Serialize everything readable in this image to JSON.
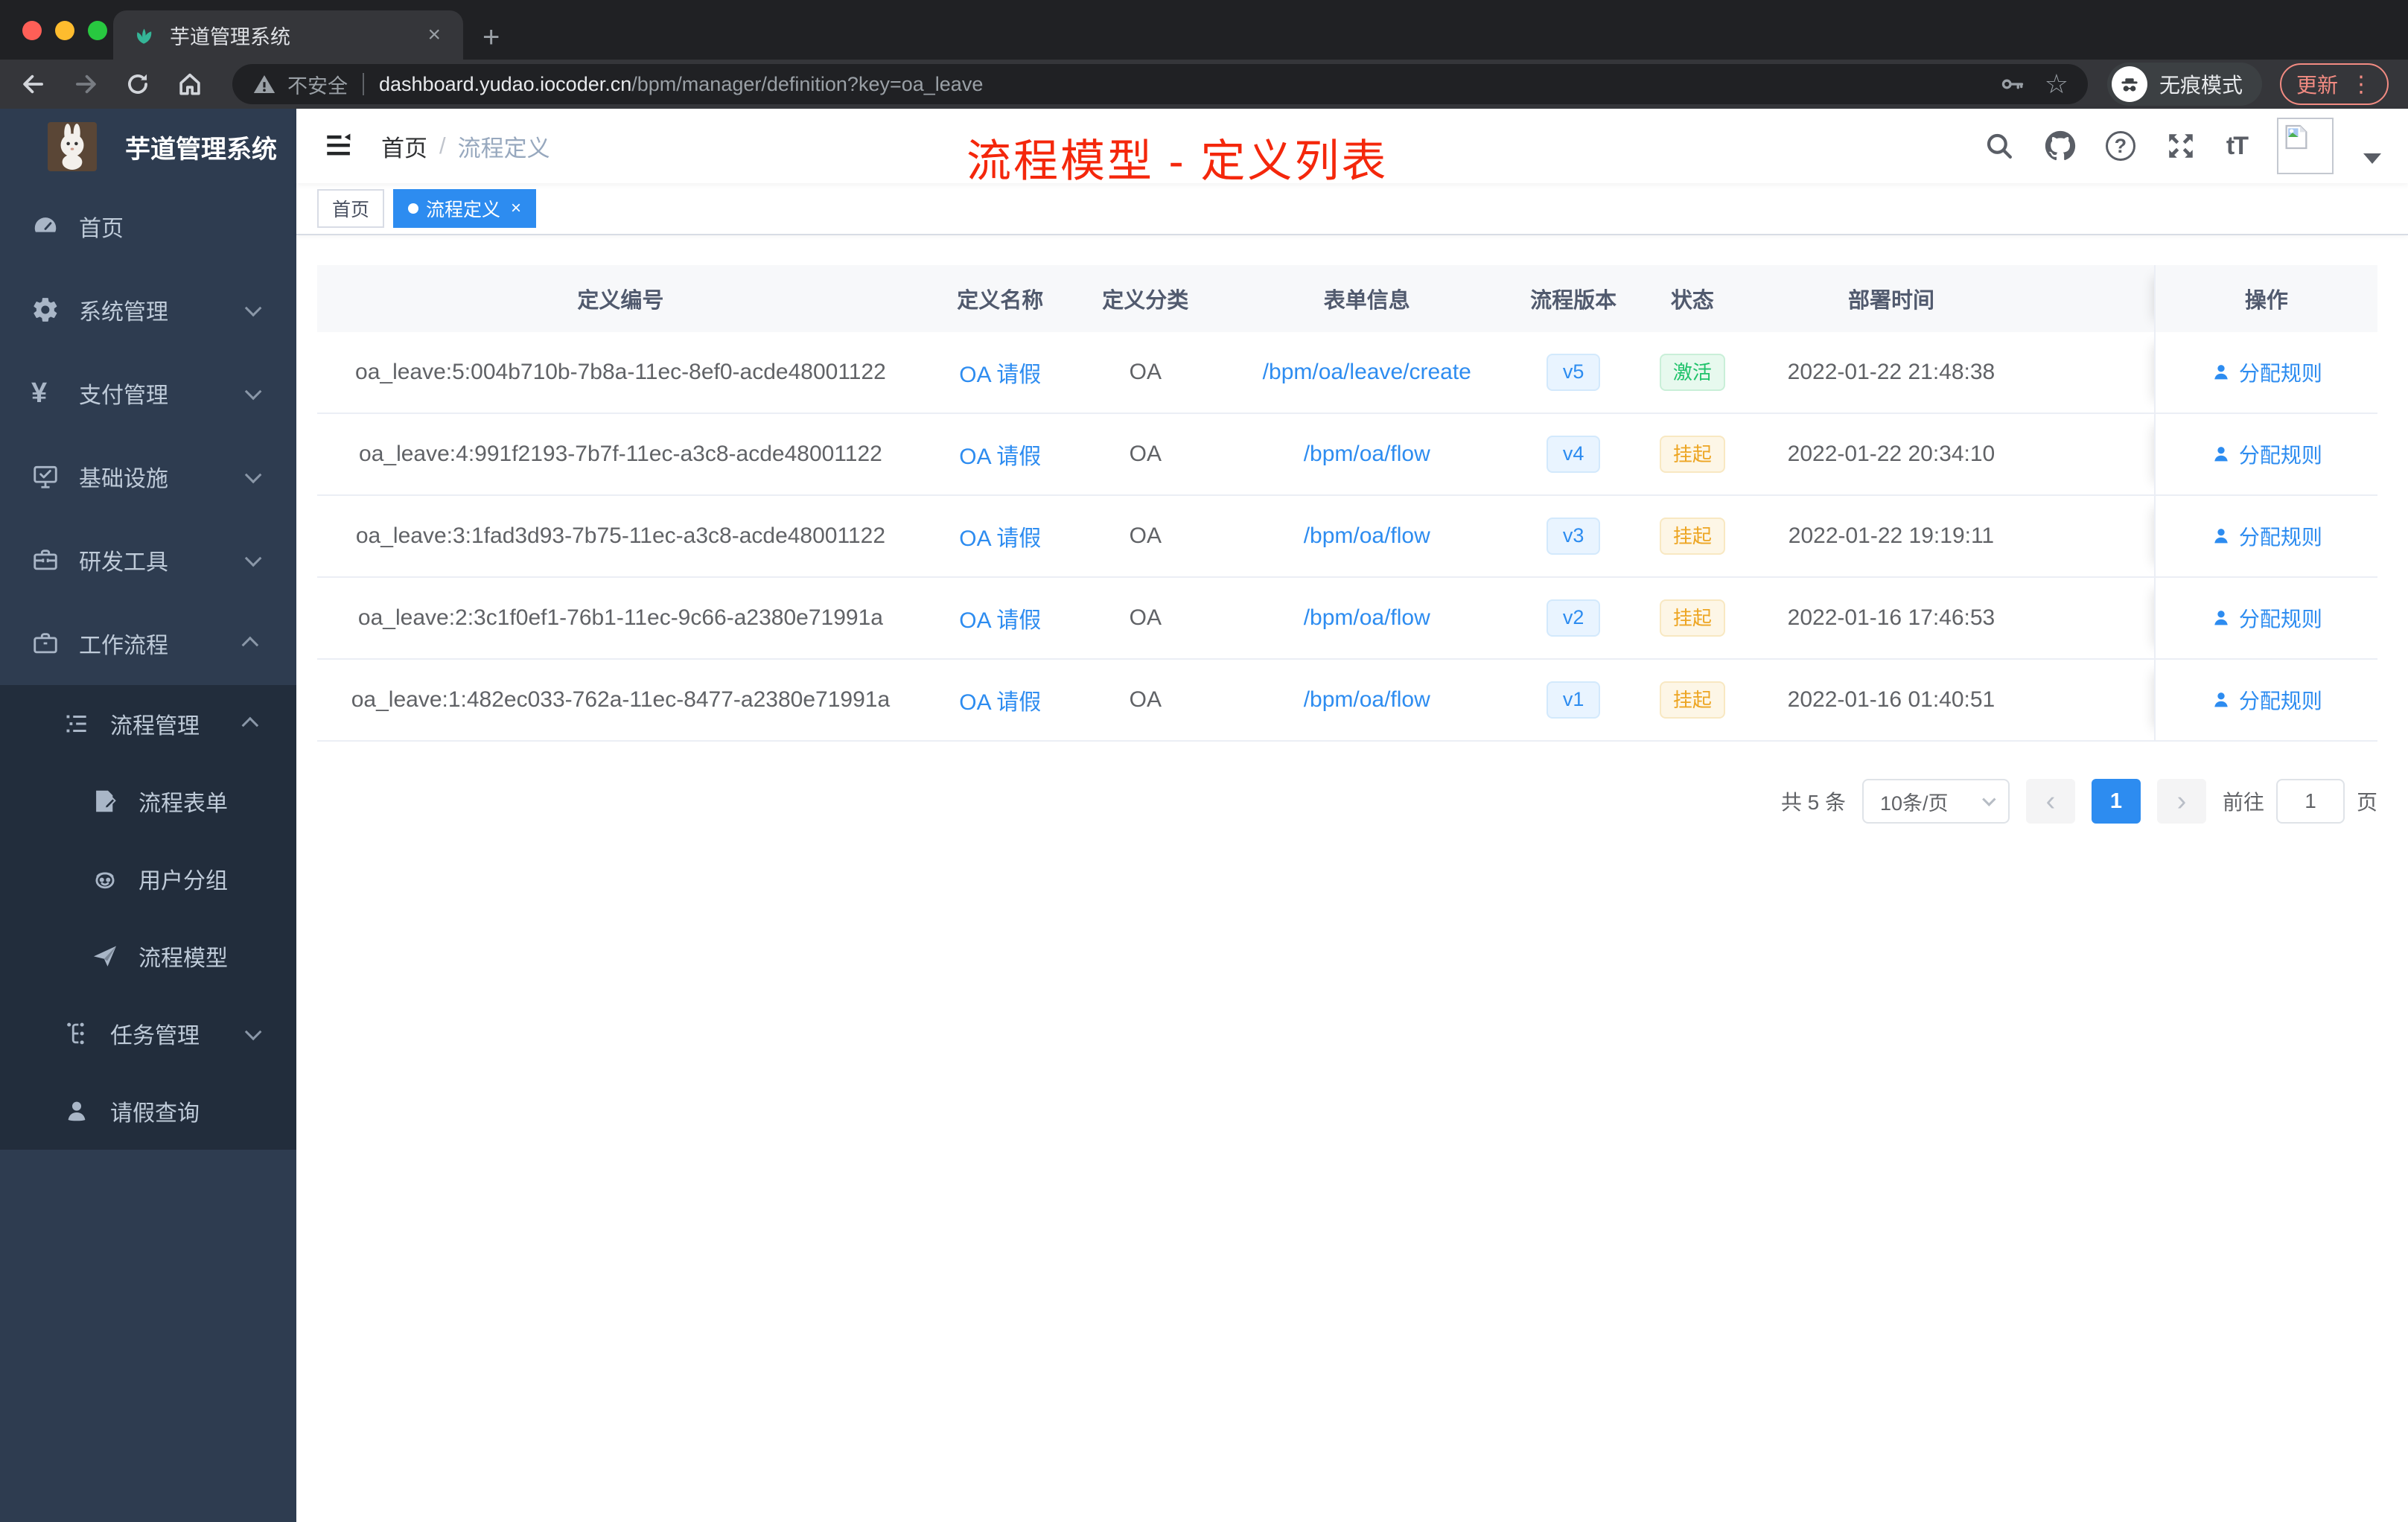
{
  "browser": {
    "tab_title": "芋道管理系统",
    "security_label": "不安全",
    "url_domain": "dashboard.yudao.iocoder.cn",
    "url_path": "/bpm/manager/definition?key=oa_leave",
    "incognito_label": "无痕模式",
    "update_label": "更新"
  },
  "icons": {
    "close": "×",
    "plus": "+",
    "star": "☆",
    "kebab": "⋮",
    "question": "?",
    "fontsize": "tT",
    "yen": "¥",
    "prev": "‹",
    "next": "›"
  },
  "sidebar": {
    "title": "芋道管理系统",
    "items": [
      {
        "key": "home",
        "label": "首页",
        "icon": "dashboard-icon",
        "chevron": ""
      },
      {
        "key": "system",
        "label": "系统管理",
        "icon": "gear-icon",
        "chevron": "down"
      },
      {
        "key": "payment",
        "label": "支付管理",
        "icon": "yen-icon",
        "chevron": "down"
      },
      {
        "key": "infra",
        "label": "基础设施",
        "icon": "monitor-icon",
        "chevron": "down"
      },
      {
        "key": "devtools",
        "label": "研发工具",
        "icon": "toolbox-icon",
        "chevron": "down"
      },
      {
        "key": "workflow",
        "label": "工作流程",
        "icon": "briefcase-icon",
        "chevron": "up"
      }
    ],
    "nested_items": [
      {
        "key": "process-mgmt",
        "label": "流程管理",
        "icon": "list-tree-icon",
        "chevron": "up",
        "level": 1
      },
      {
        "key": "process-form",
        "label": "流程表单",
        "icon": "form-edit-icon",
        "chevron": "",
        "level": 2
      },
      {
        "key": "user-group",
        "label": "用户分组",
        "icon": "robot-icon",
        "chevron": "",
        "level": 2
      },
      {
        "key": "process-model",
        "label": "流程模型",
        "icon": "paper-plane-icon",
        "chevron": "",
        "level": 2
      },
      {
        "key": "task-mgmt",
        "label": "任务管理",
        "icon": "flow-icon",
        "chevron": "down",
        "level": 1
      },
      {
        "key": "leave-query",
        "label": "请假查询",
        "icon": "user-icon",
        "chevron": "",
        "level": 1
      }
    ]
  },
  "navbar": {
    "breadcrumb_home": "首页",
    "breadcrumb_sep": "/",
    "breadcrumb_current": "流程定义",
    "annotation": "流程模型 - 定义列表"
  },
  "tags": [
    {
      "key": "home",
      "label": "首页",
      "active": false,
      "closable": false
    },
    {
      "key": "process-definition",
      "label": "流程定义",
      "active": true,
      "closable": true
    }
  ],
  "table": {
    "columns": [
      "定义编号",
      "定义名称",
      "定义分类",
      "表单信息",
      "流程版本",
      "状态",
      "部署时间",
      "操作"
    ],
    "rows": [
      {
        "id": "oa_leave:5:004b710b-7b8a-11ec-8ef0-acde48001122",
        "name": "OA 请假",
        "category": "OA",
        "form": "/bpm/oa/leave/create",
        "version": "v5",
        "status": "激活",
        "status_type": "success",
        "time": "2022-01-22 21:48:38",
        "action": "分配规则"
      },
      {
        "id": "oa_leave:4:991f2193-7b7f-11ec-a3c8-acde48001122",
        "name": "OA 请假",
        "category": "OA",
        "form": "/bpm/oa/flow",
        "version": "v4",
        "status": "挂起",
        "status_type": "warning",
        "time": "2022-01-22 20:34:10",
        "action": "分配规则"
      },
      {
        "id": "oa_leave:3:1fad3d93-7b75-11ec-a3c8-acde48001122",
        "name": "OA 请假",
        "category": "OA",
        "form": "/bpm/oa/flow",
        "version": "v3",
        "status": "挂起",
        "status_type": "warning",
        "time": "2022-01-22 19:19:11",
        "action": "分配规则"
      },
      {
        "id": "oa_leave:2:3c1f0ef1-76b1-11ec-9c66-a2380e71991a",
        "name": "OA 请假",
        "category": "OA",
        "form": "/bpm/oa/flow",
        "version": "v2",
        "status": "挂起",
        "status_type": "warning",
        "time": "2022-01-16 17:46:53",
        "action": "分配规则"
      },
      {
        "id": "oa_leave:1:482ec033-762a-11ec-8477-a2380e71991a",
        "name": "OA 请假",
        "category": "OA",
        "form": "/bpm/oa/flow",
        "version": "v1",
        "status": "挂起",
        "status_type": "warning",
        "time": "2022-01-16 01:40:51",
        "action": "分配规则"
      }
    ]
  },
  "pagination": {
    "total": "共 5 条",
    "page_size": "10条/页",
    "current": "1",
    "goto_label": "前往",
    "goto_value": "1",
    "page_suffix": "页"
  },
  "colors": {
    "accent_blue": "#2d8cf0",
    "success_green": "#1fc26a",
    "warning_orange": "#eda522",
    "annotation_red": "#f4270b",
    "sidebar_bg": "#2e3c50",
    "sidebar_nested_bg": "#222d3c",
    "active_tag_bg": "#2d8cf0"
  }
}
